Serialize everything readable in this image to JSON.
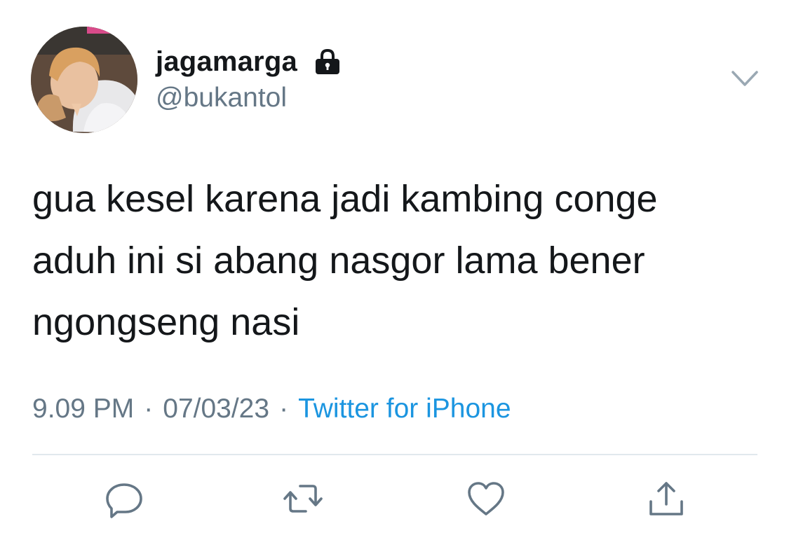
{
  "tweet": {
    "display_name": "jagamarga",
    "handle": "@bukantol",
    "text": "gua kesel karena jadi kambing conge\naduh ini si abang nasgor lama bener\nngongseng nasi",
    "time": "9.09 PM",
    "separator": "·",
    "date": "07/03/23",
    "source": "Twitter for iPhone"
  },
  "icons": {
    "lock": "lock-icon",
    "caret": "chevron-down-icon",
    "reply": "reply-icon",
    "retweet": "retweet-icon",
    "like": "heart-icon",
    "share": "share-icon"
  },
  "colors": {
    "text": "#14171a",
    "secondary": "#657786",
    "link": "#1b95e0",
    "icon": "#657786",
    "divider": "#e1e8ed"
  }
}
